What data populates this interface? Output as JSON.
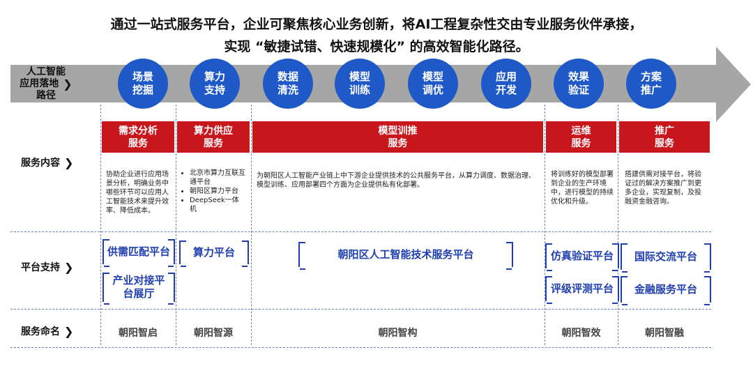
{
  "title": {
    "line1": "通过一站式服务平台，企业可聚焦核心业务创新，将AI工程复杂性交由专业服务伙伴承接，",
    "line2": "实现 “敏捷试错、快速规模化” 的高效智能化路径。"
  },
  "rows": {
    "path_l1": "人工智能",
    "path_l2": "应用落地",
    "path_l3": "路径",
    "content": "服务内容",
    "platform": "平台支持",
    "naming": "服务命名",
    "chevron": "❯"
  },
  "steps": [
    {
      "l1": "场景",
      "l2": "挖掘"
    },
    {
      "l1": "算力",
      "l2": "支持"
    },
    {
      "l1": "数据",
      "l2": "清洗"
    },
    {
      "l1": "模型",
      "l2": "训练"
    },
    {
      "l1": "模型",
      "l2": "调优"
    },
    {
      "l1": "应用",
      "l2": "开发"
    },
    {
      "l1": "效果",
      "l2": "验证"
    },
    {
      "l1": "方案",
      "l2": "推广"
    }
  ],
  "services": [
    {
      "l1": "需求分析",
      "l2": "服务"
    },
    {
      "l1": "算力供应",
      "l2": "服务"
    },
    {
      "l1": "模型训推",
      "l2": "服务"
    },
    {
      "l1": "运维",
      "l2": "服务"
    },
    {
      "l1": "推广",
      "l2": "服务"
    }
  ],
  "descriptions": {
    "demand": "协助企业进行应用场景分析，明确业务中哪些环节可以应用人工智能技术来提升效率、降低成本。",
    "compute": [
      "北京市算力互联互通平台",
      "朝阳区算力平台",
      "DeepSeek一体机"
    ],
    "training": "为朝阳区人工智能产业链上中下游企业提供技术的公共服务平台，从算力调度、数据治理、模型训练、应用部署四个方面为企业提供私有化部署。",
    "ops": "将训练好的模型部署到企业的生产环境中，进行模型的持续优化和升级。",
    "promo": "搭建供需对接平台，将验证过的解决方案推广到更多企业，实现复制，及投融资金融咨询。"
  },
  "platforms": {
    "p1": "供需匹配平台",
    "p2": "产业对接平台展厅",
    "p3": "算力平台",
    "p4": "朝阳区人工智能技术服务平台",
    "p5": "仿真验证平台",
    "p6": "评级评测平台",
    "p7": "国际交流平台",
    "p8": "金融服务平台"
  },
  "names": [
    "朝阳智启",
    "朝阳智源",
    "朝阳智构",
    "朝阳智效",
    "朝阳智融"
  ],
  "colors": {
    "accent_blue": "#1f59c8",
    "accent_red": "#c8161d",
    "platform_blue": "#1f3fae",
    "band_gray": "#a6a6a6"
  }
}
